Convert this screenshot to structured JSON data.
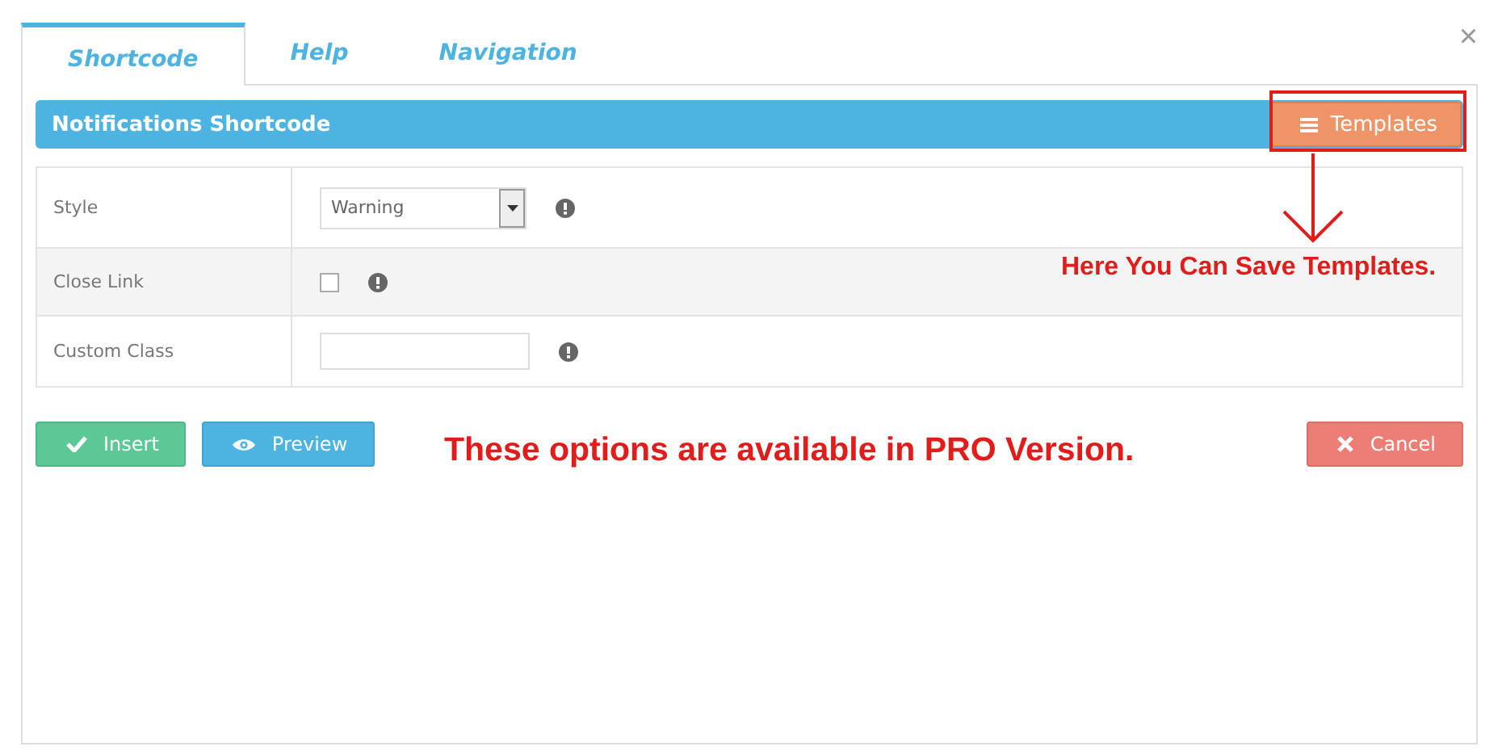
{
  "tabs": [
    {
      "label": "Shortcode",
      "selected": true
    },
    {
      "label": "Help",
      "selected": false
    },
    {
      "label": "Navigation",
      "selected": false
    }
  ],
  "close_button": "×",
  "header": {
    "title": "Notifications Shortcode",
    "button": "Templates"
  },
  "fields": [
    {
      "kind": "select",
      "label": "Style",
      "value": "Warning"
    },
    {
      "kind": "checkbox",
      "label": "Close Link",
      "checked": false
    },
    {
      "kind": "text",
      "label": "Custom Class"
    }
  ],
  "buttons": [
    {
      "kind": "insert",
      "label": "Insert"
    },
    {
      "kind": "preview",
      "label": "Preview"
    },
    {
      "kind": "cancel",
      "label": "Cancel"
    }
  ],
  "annotations": {
    "templates_note": "Here You Can Save Templates.",
    "pro_note": "These options are available in PRO Version."
  }
}
